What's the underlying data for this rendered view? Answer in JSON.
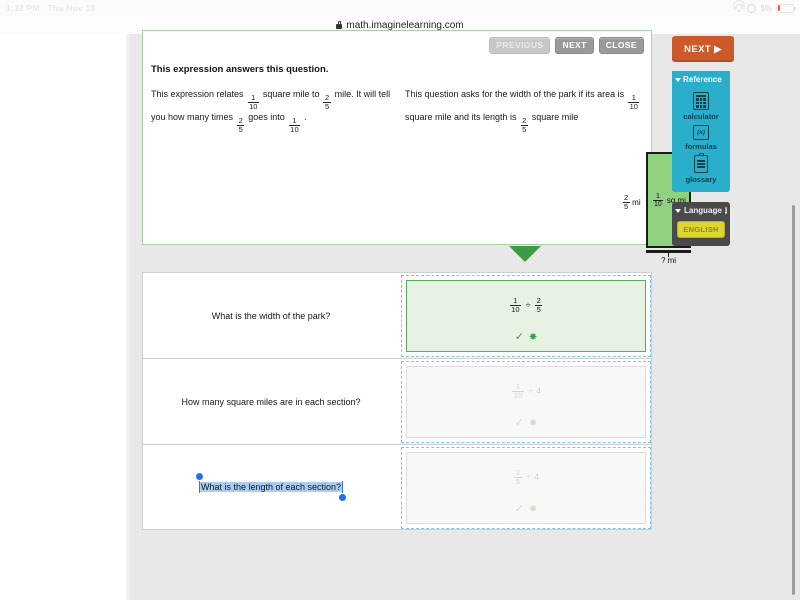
{
  "statusbar": {
    "time": "1:32 PM",
    "date": "Thu Nov 19",
    "battery_percent": "5%",
    "wifi_icon": "wifi-icon",
    "alarm_icon": "alarm-icon",
    "battery_icon": "battery-icon"
  },
  "browser": {
    "url": "math.imaginelearning.com",
    "lock_icon": "lock-icon"
  },
  "top_panel": {
    "nav": {
      "previous": "PREVIOUS",
      "next": "NEXT",
      "close": "CLOSE"
    },
    "title": "This expression answers this question.",
    "left_column": {
      "p1_a": "This expression relates",
      "f1": {
        "num": "1",
        "den": "10"
      },
      "p1_b": "square mile to",
      "f2": {
        "num": "2",
        "den": "5"
      },
      "p1_c": "mile. It will tell you how many times",
      "f3": {
        "num": "2",
        "den": "5"
      },
      "p1_d": "goes into",
      "f4": {
        "num": "1",
        "den": "10"
      },
      "p1_e": "."
    },
    "right_column": {
      "p2_a": "This question asks for the width of the park if its area is",
      "f1": {
        "num": "1",
        "den": "10"
      },
      "p2_b": "square mile and its length is",
      "f2": {
        "num": "2",
        "den": "5"
      },
      "p2_c": "square mile"
    },
    "diagram": {
      "left_label": {
        "num": "2",
        "den": "5"
      },
      "left_unit": "mi",
      "inside_label": {
        "num": "1",
        "den": "10"
      },
      "inside_unit": "sq mi",
      "bottom_label": "? mi",
      "fill_color": "#90d180",
      "stroke_color": "#1c1c1c"
    },
    "pointer_color": "#3d9b48"
  },
  "match_rows": [
    {
      "prompt": "What is the width of the park?",
      "selected": false,
      "answer": {
        "left": {
          "num": "1",
          "den": "10"
        },
        "op": "÷",
        "right_frac": {
          "num": "2",
          "den": "5"
        },
        "right_plain": ""
      },
      "correct": true,
      "check_icon": "check-icon",
      "sparkle_icon": "sparkle-icon"
    },
    {
      "prompt": "How many square miles are in each section?",
      "selected": false,
      "answer": {
        "left": {
          "num": "1",
          "den": "10"
        },
        "op": "÷",
        "right_frac": null,
        "right_plain": "4"
      },
      "correct": false,
      "check_icon": "check-icon",
      "sparkle_icon": "sparkle-icon"
    },
    {
      "prompt": "What is the length of each section?",
      "selected": true,
      "answer": {
        "left": {
          "num": "2",
          "den": "5"
        },
        "op": "÷",
        "right_frac": null,
        "right_plain": "4"
      },
      "correct": false,
      "check_icon": "check-icon",
      "sparkle_icon": "sparkle-icon"
    }
  ],
  "rail": {
    "next_label": "NEXT",
    "next_arrow": "▶",
    "next_color": "#cd5a2b",
    "reference": {
      "header": "Reference",
      "header_color": "#29aecb",
      "collapse_icon": "triangle-down-icon",
      "tools": [
        {
          "label": "calculator",
          "icon": "calculator-icon"
        },
        {
          "label": "formulas",
          "icon": "formulas-icon",
          "glyph": "(x)"
        },
        {
          "label": "glossary",
          "icon": "clipboard-icon"
        }
      ]
    },
    "language": {
      "header": "Language",
      "info_icon": "info-icon",
      "info_glyph": "i",
      "collapse_icon": "triangle-down-icon",
      "button_label": "ENGLISH",
      "button_color": "#ddd532"
    }
  }
}
